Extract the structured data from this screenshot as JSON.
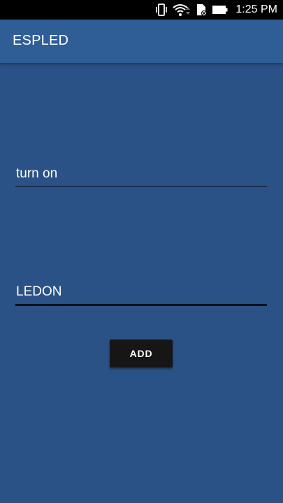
{
  "status_bar": {
    "time": "1:25 PM",
    "icons": [
      "vibrate-icon",
      "wifi-icon",
      "sd-card-error-icon",
      "battery-icon"
    ]
  },
  "app_bar": {
    "title": "ESPLED"
  },
  "form": {
    "field1": {
      "value": "turn on"
    },
    "field2": {
      "value": "LEDON"
    },
    "add_button_label": "ADD"
  },
  "colors": {
    "background": "#2b5286",
    "app_bar": "#2f5d96",
    "button": "#161616",
    "text": "#ffffff"
  }
}
